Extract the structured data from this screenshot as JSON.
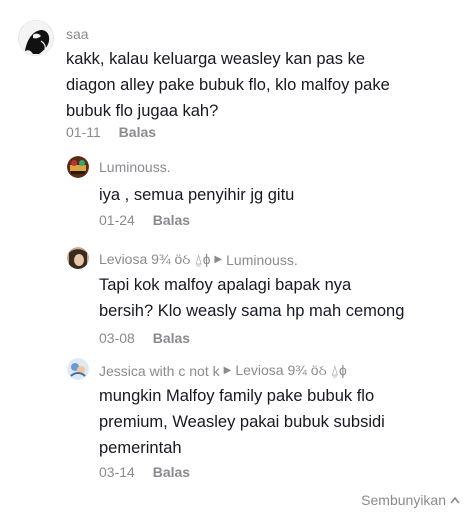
{
  "comment": {
    "username": "saa",
    "text_line1": "kakk, kalau keluarga weasley kan pas ke",
    "text_line2": "diagon alley pake bubuk flo, klo malfoy pake",
    "text_line3": "bubuk flo jugaa kah?",
    "date": "01-11",
    "reply_label": "Balas"
  },
  "replies": [
    {
      "username": "Luminouss.",
      "text_line1": "iya , semua penyihir jg gitu",
      "date": "01-24",
      "reply_label": "Balas"
    },
    {
      "username": "Leviosa 9¾ ӧઠ ⍙ɸ",
      "reply_to": "Luminouss.",
      "text_line1": "Tapi kok malfoy apalagi bapak nya",
      "text_line2": "bersih? Klo weasly sama hp mah cemong",
      "date": "03-08",
      "reply_label": "Balas"
    },
    {
      "username": "Jessica with c not k",
      "reply_to": "Leviosa 9¾ ӧઠ ⍙ɸ",
      "text_line1": "mungkin Malfoy family pake bubuk flo",
      "text_line2": "premium, Weasley pakai bubuk subsidi",
      "text_line3": "pemerintah",
      "date": "03-14",
      "reply_label": "Balas"
    }
  ],
  "footer": {
    "hide_label": "Sembunyikan"
  }
}
